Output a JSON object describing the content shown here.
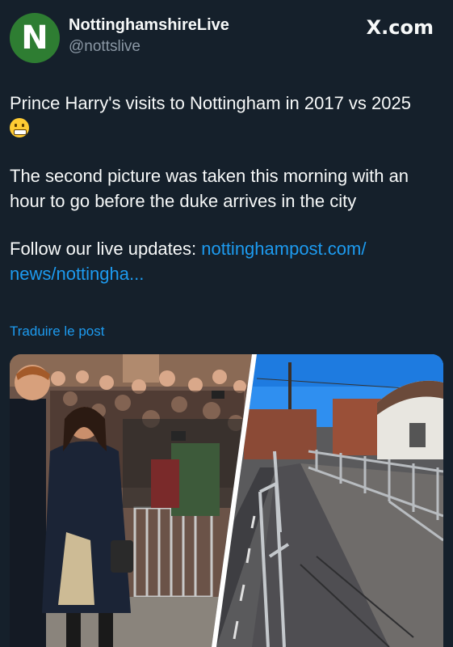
{
  "post": {
    "avatar_letter": "N",
    "display_name": "NottinghamshireLive",
    "handle": "@nottslive",
    "site_logo": "X.com",
    "line1": "Prince Harry's visits to Nottingham in 2017 vs 2025",
    "emoji": "grimacing-face-emoji",
    "line2": "The second picture was taken this morning with an hour to go before the duke arrives in the city",
    "line3_prefix": "Follow our live updates: ",
    "line3_link": "nottinghampost.com/ news/nottingha...",
    "translate_label": "Traduire le post"
  },
  "colors": {
    "background": "#15202b",
    "link": "#1d9bf0",
    "avatar": "#2e7d32"
  }
}
